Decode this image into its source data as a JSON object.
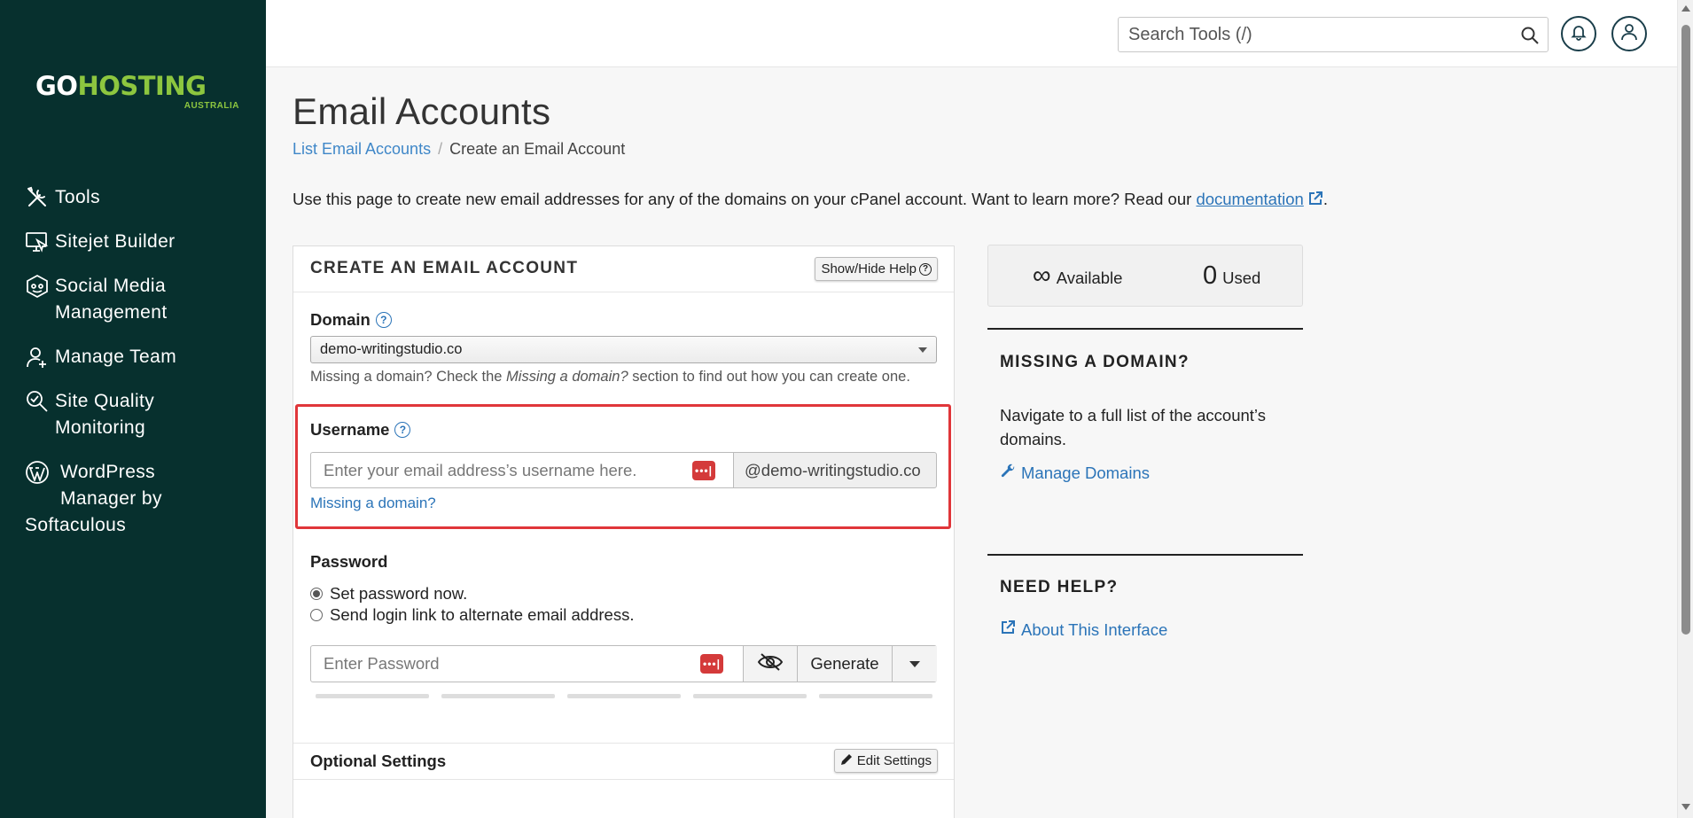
{
  "brand": {
    "name_part1": "GO",
    "name_part2": "HOSTING",
    "sub": "AUSTRALIA",
    "accent": "#8dc63f",
    "sidebar_bg": "#07302e"
  },
  "sidebar": {
    "items": [
      {
        "label": "Tools",
        "icon": "tools-icon"
      },
      {
        "label": "Sitejet Builder",
        "icon": "monitor-icon"
      },
      {
        "label": "Social Media Management",
        "label_line1": "Social Media",
        "label_line2": "Management",
        "icon": "social-icon"
      },
      {
        "label": "Manage Team",
        "icon": "team-icon"
      },
      {
        "label": "Site Quality Monitoring",
        "label_line1": "Site Quality",
        "label_line2": "Monitoring",
        "icon": "quality-icon"
      },
      {
        "label": "WordPress Manager by Softaculous",
        "label_line1": "WordPress",
        "label_line2": "Manager by",
        "label_line3": "Softaculous",
        "icon": "wordpress-icon"
      }
    ]
  },
  "header": {
    "search_placeholder": "Search Tools (/)"
  },
  "main": {
    "title": "Email Accounts",
    "breadcrumb": {
      "parent": "List Email Accounts",
      "current": "Create an Email Account"
    },
    "intro_text": "Use this page to create new email addresses for any of the domains on your cPanel account. Want to learn more? Read our",
    "intro_link": "documentation",
    "intro_end": "."
  },
  "form": {
    "title": "CREATE AN EMAIL ACCOUNT",
    "help_button": "Show/Hide Help",
    "domain_label": "Domain",
    "domain_value": "demo-writingstudio.co",
    "domain_hint_pre": "Missing a domain? Check the",
    "domain_hint_em": "Missing a domain?",
    "domain_hint_post": "section to find out how you can create one.",
    "username_label": "Username",
    "username_placeholder": "Enter your email address’s username here.",
    "username_suffix": "@demo-writingstudio.co",
    "missing_link": "Missing a domain?",
    "password_label": "Password",
    "radio_set": "Set password now.",
    "radio_send": "Send login link to alternate email address.",
    "password_placeholder": "Enter Password",
    "generate_label": "Generate",
    "optional_title": "Optional Settings",
    "edit_settings": "Edit Settings"
  },
  "stats": {
    "available_value": "∞",
    "available_label": "Available",
    "used_value": "0",
    "used_label": "Used"
  },
  "side": {
    "missing_title": "MISSING A DOMAIN?",
    "missing_text": "Navigate to a full list of the account’s domains.",
    "manage_link": "Manage Domains",
    "help_title": "NEED HELP?",
    "about_link": "About This Interface"
  }
}
